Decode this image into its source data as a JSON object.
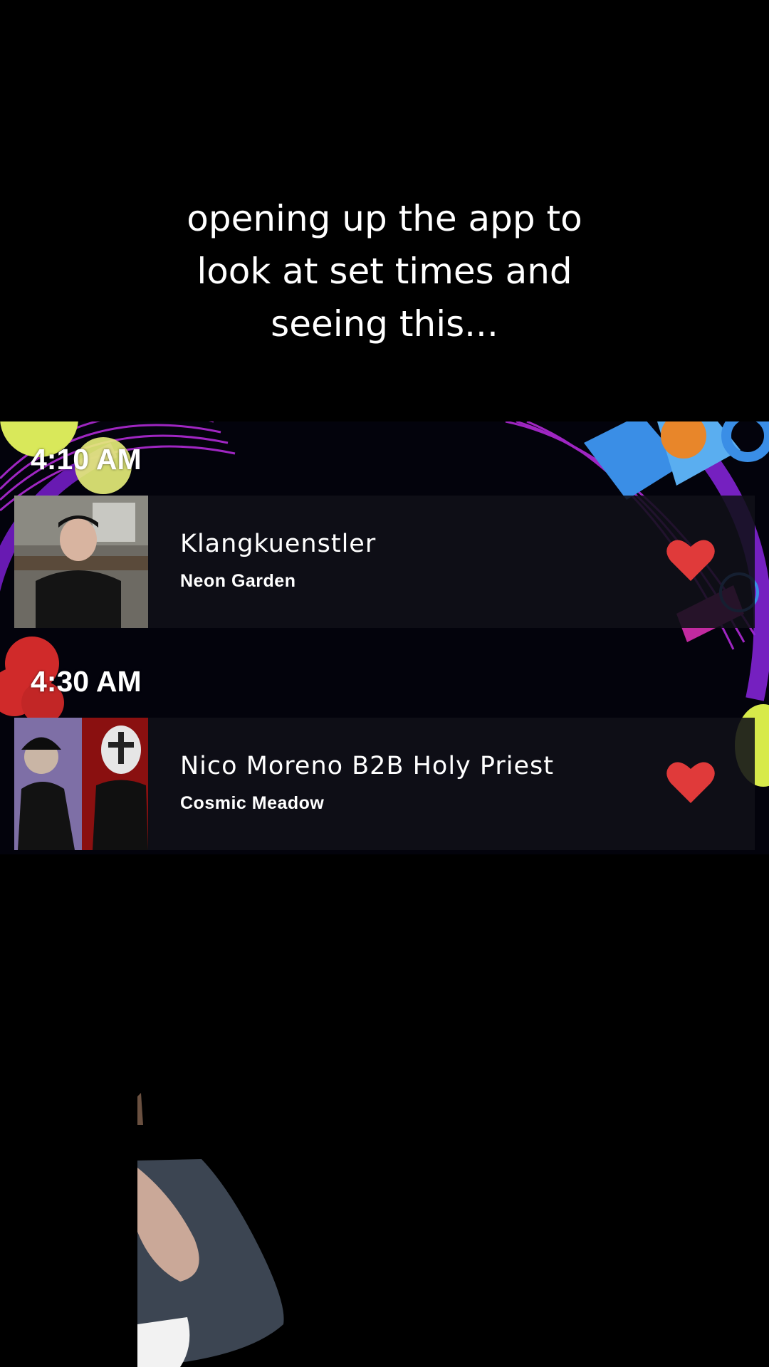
{
  "caption": {
    "lines": [
      "opening up the app to",
      "look at set times and",
      "seeing this..."
    ]
  },
  "schedule": {
    "slots": [
      {
        "time": "4:10 AM",
        "artist": "Klangkuenstler",
        "stage": "Neon Garden"
      },
      {
        "time": "4:30 AM",
        "artist": "Nico Moreno B2B Holy Priest",
        "stage": "Cosmic Meadow"
      }
    ]
  },
  "icons": {
    "favorite": "heart-icon"
  },
  "colors": {
    "background": "#000000",
    "card": "#101018",
    "heart": "#e03a3a",
    "neon_purple": "#b02ad6",
    "neon_blue": "#3a8ee6"
  }
}
